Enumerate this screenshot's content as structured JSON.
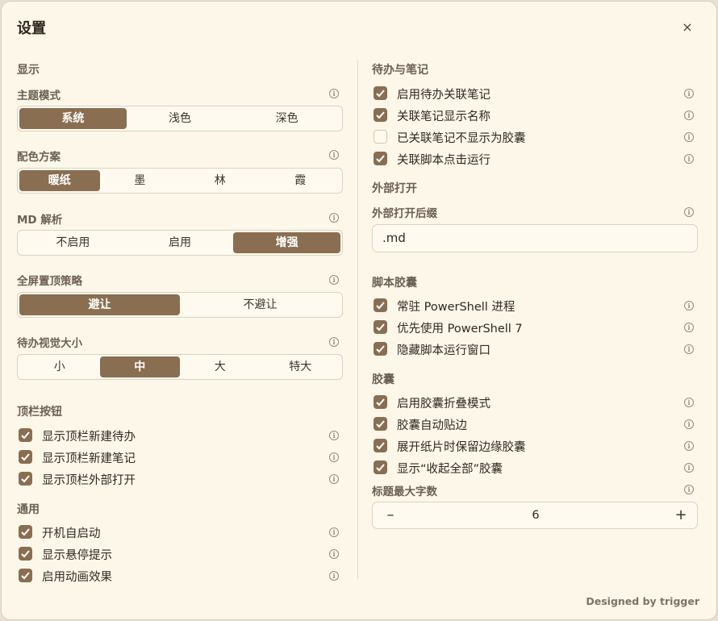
{
  "dialog": {
    "title": "设置",
    "close_icon": "×"
  },
  "left": {
    "display": {
      "heading": "显示",
      "theme_mode": {
        "label": "主题模式",
        "options": [
          "系统",
          "浅色",
          "深色"
        ],
        "selected": "系统"
      },
      "color_scheme": {
        "label": "配色方案",
        "options": [
          "暖纸",
          "墨",
          "林",
          "霞"
        ],
        "selected": "暖纸"
      },
      "md_parse": {
        "label": "MD 解析",
        "options": [
          "不启用",
          "启用",
          "增强"
        ],
        "selected": "增强"
      },
      "fullscreen_pin": {
        "label": "全屏置顶策略",
        "options": [
          "避让",
          "不避让"
        ],
        "selected": "避让"
      },
      "todo_size": {
        "label": "待办视觉大小",
        "options": [
          "小",
          "中",
          "大",
          "特大"
        ],
        "selected": "中"
      }
    },
    "topbar": {
      "heading": "顶栏按钮",
      "items": [
        {
          "label": "显示顶栏新建待办",
          "checked": true
        },
        {
          "label": "显示顶栏新建笔记",
          "checked": true
        },
        {
          "label": "显示顶栏外部打开",
          "checked": true
        }
      ]
    },
    "general": {
      "heading": "通用",
      "items": [
        {
          "label": "开机自启动",
          "checked": true
        },
        {
          "label": "显示悬停提示",
          "checked": true
        },
        {
          "label": "启用动画效果",
          "checked": true
        }
      ]
    }
  },
  "right": {
    "todo_notes": {
      "heading": "待办与笔记",
      "items": [
        {
          "label": "启用待办关联笔记",
          "checked": true
        },
        {
          "label": "关联笔记显示名称",
          "checked": true
        },
        {
          "label": "已关联笔记不显示为胶囊",
          "checked": false
        },
        {
          "label": "关联脚本点击运行",
          "checked": true
        }
      ]
    },
    "external": {
      "heading": "外部打开",
      "suffix_label": "外部打开后缀",
      "suffix_value": ".md"
    },
    "script": {
      "heading": "脚本胶囊",
      "items": [
        {
          "label": "常驻 PowerShell 进程",
          "checked": true
        },
        {
          "label": "优先使用 PowerShell 7",
          "checked": true
        },
        {
          "label": "隐藏脚本运行窗口",
          "checked": true
        }
      ]
    },
    "capsule": {
      "heading": "胶囊",
      "items": [
        {
          "label": "启用胶囊折叠模式",
          "checked": true
        },
        {
          "label": "胶囊自动贴边",
          "checked": true
        },
        {
          "label": "展开纸片时保留边缘胶囊",
          "checked": true
        },
        {
          "label": "显示“收起全部”胶囊",
          "checked": true
        }
      ],
      "max_chars_label": "标题最大字数",
      "max_chars_value": "6",
      "minus_icon": "–",
      "plus_icon": "+"
    }
  },
  "footer": "Designed by trigger",
  "icons": {
    "info": "info-icon",
    "check": "check-icon"
  },
  "colors": {
    "accent": "#8a6e51",
    "background": "#fdf7ea",
    "border": "#ddd2bf"
  }
}
